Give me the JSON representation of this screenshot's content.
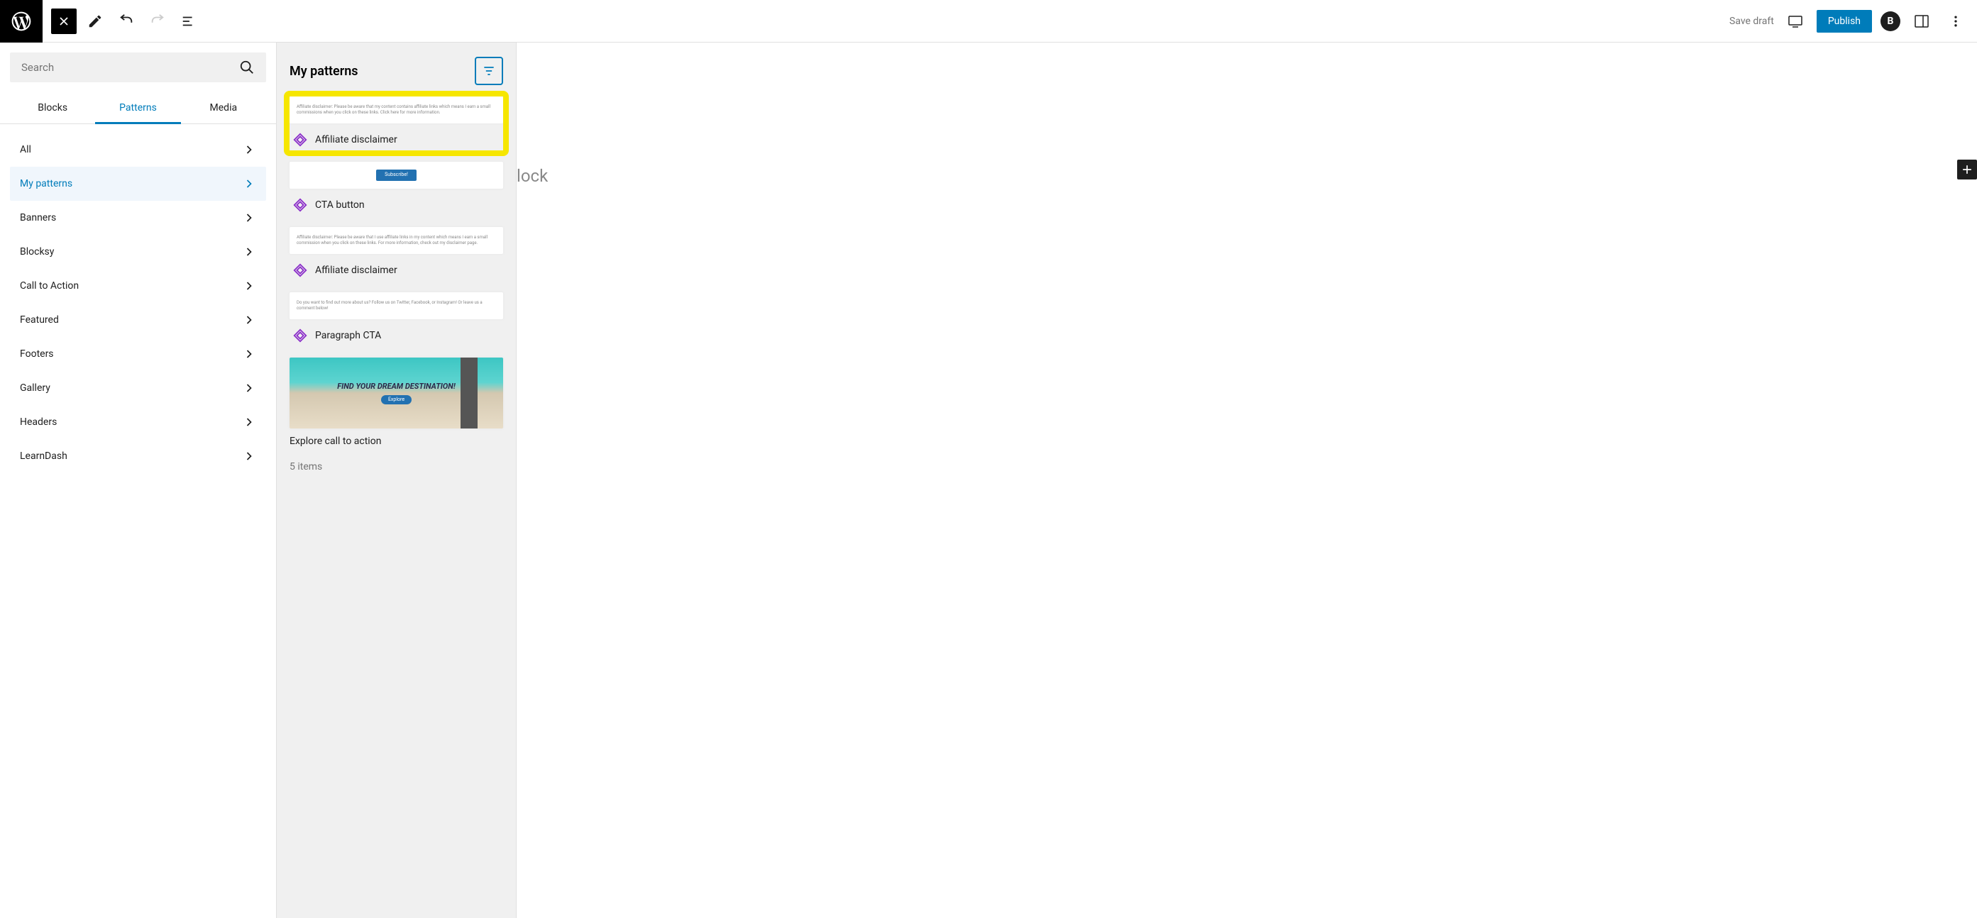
{
  "toolbar": {
    "save_draft": "Save draft",
    "publish": "Publish"
  },
  "search": {
    "placeholder": "Search"
  },
  "tabs": {
    "blocks": "Blocks",
    "patterns": "Patterns",
    "media": "Media"
  },
  "categories": [
    {
      "label": "All",
      "selected": false
    },
    {
      "label": "My patterns",
      "selected": true
    },
    {
      "label": "Banners",
      "selected": false
    },
    {
      "label": "Blocksy",
      "selected": false
    },
    {
      "label": "Call to Action",
      "selected": false
    },
    {
      "label": "Featured",
      "selected": false
    },
    {
      "label": "Footers",
      "selected": false
    },
    {
      "label": "Gallery",
      "selected": false
    },
    {
      "label": "Headers",
      "selected": false
    },
    {
      "label": "LearnDash",
      "selected": false
    }
  ],
  "patterns_panel": {
    "title": "My patterns",
    "items": [
      {
        "name": "Affiliate disclaimer",
        "highlighted": true,
        "preview_text": "Affiliate disclaimer: Please be aware that my content contains affiliate links which means I earn a small commissions when you click on these links. Click here for more information."
      },
      {
        "name": "CTA button",
        "preview_button": "Subscribe!"
      },
      {
        "name": "Affiliate disclaimer",
        "preview_text": "Affiliate disclaimer: Please be aware that I use affiliate links in my content which means I earn a small commission when you click on these links. For more information, check out my disclaimer page."
      },
      {
        "name": "Paragraph CTA",
        "preview_text": "Do you want to find out more about us? Follow us on Twitter, Facebook, or Instagram! Or leave us a comment below!"
      },
      {
        "name": "Explore call to action",
        "is_image": true,
        "image_headline": "FIND YOUR DREAM DESTINATION!",
        "image_button": "Explore"
      }
    ],
    "count_label": "5 items"
  },
  "editor": {
    "type_prompt": "lock"
  }
}
